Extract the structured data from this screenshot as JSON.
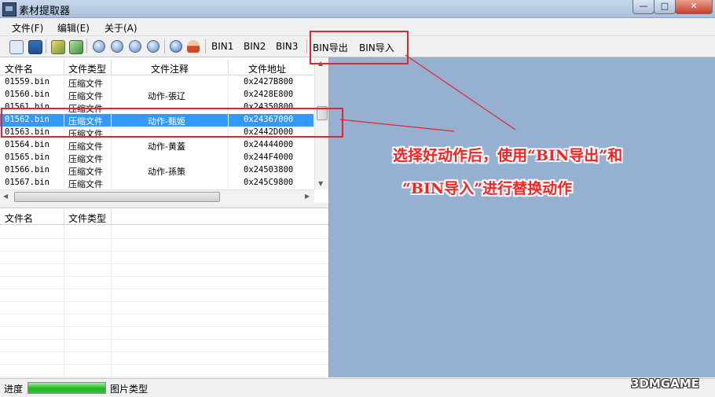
{
  "window": {
    "title": "素材提取器",
    "min_label": "—",
    "max_label": "□",
    "close_label": "✕"
  },
  "menu": [
    "文件(F)",
    "编辑(E)",
    "关于(A)"
  ],
  "toolbar": {
    "bin_buttons": [
      "BIN1",
      "BIN2",
      "BIN3",
      "BIN导出",
      "BIN导入"
    ]
  },
  "file_table": {
    "columns": [
      "文件名",
      "文件类型",
      "文件注释",
      "文件地址"
    ],
    "rows": [
      [
        "01559.bin",
        "压缩文件",
        "",
        "0x2427B800"
      ],
      [
        "01560.bin",
        "压缩文件",
        "动作-張辽",
        "0x2428E800"
      ],
      [
        "01561.bin",
        "压缩文件",
        "",
        "0x24350800"
      ],
      [
        "01562.bin",
        "压缩文件",
        "动作-甄姬",
        "0x24367000"
      ],
      [
        "01563.bin",
        "压缩文件",
        "",
        "0x2442D000"
      ],
      [
        "01564.bin",
        "压缩文件",
        "动作-黄蓋",
        "0x24444000"
      ],
      [
        "01565.bin",
        "压缩文件",
        "",
        "0x244F4000"
      ],
      [
        "01566.bin",
        "压缩文件",
        "动作-孫策",
        "0x24503800"
      ],
      [
        "01567.bin",
        "压缩文件",
        "",
        "0x245C9800"
      ]
    ],
    "selected_row": 3
  },
  "sub_table": {
    "columns": [
      "文件名",
      "文件类型"
    ]
  },
  "status": {
    "progress_label": "进度",
    "progress_value": 1.0,
    "type_label": "图片类型"
  },
  "annotation": {
    "line1": "选择好动作后，使用“BIN导出”和",
    "line2": "“BIN导入”进行替换动作",
    "color": "#ff2020"
  },
  "watermark": "3DMGAME"
}
